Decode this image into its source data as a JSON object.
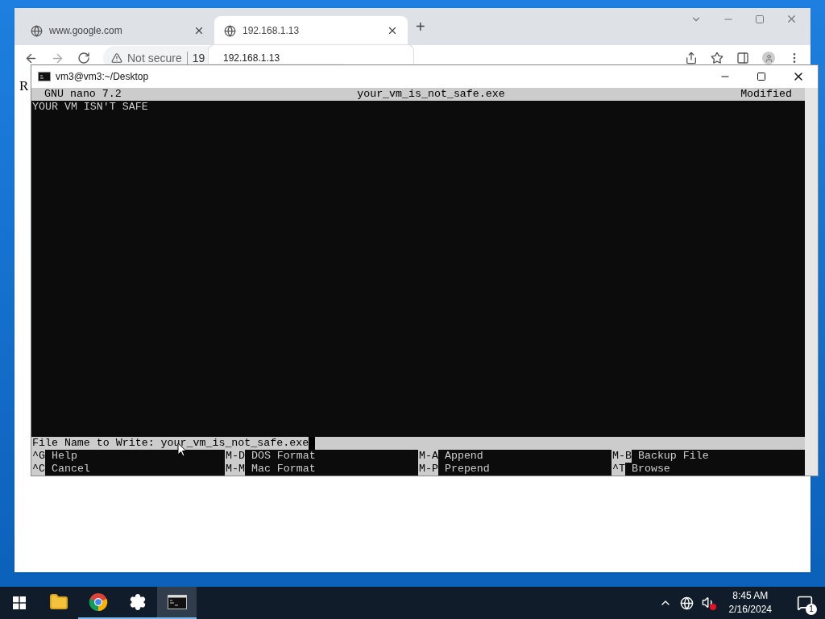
{
  "browser": {
    "tabs": [
      {
        "title": "www.google.com",
        "selected": false
      },
      {
        "title": "192.168.1.13",
        "selected": true
      }
    ],
    "new_tab": "+",
    "security": "Not secure",
    "url": "19",
    "suggestion": "192.168.1.13",
    "page_text": "R"
  },
  "terminal": {
    "title": "vm3@vm3:~/Desktop",
    "header": {
      "app": "GNU nano 7.2",
      "file": "your_vm_is_not_safe.exe",
      "status": "Modified"
    },
    "lines": [
      "YOUR VM ISN'T SAFE"
    ],
    "prompt": {
      "label": "File Name to Write: ",
      "value": "your_vm_is_not_safe.exe"
    },
    "shortcuts": [
      [
        {
          "key": "^G",
          "label": "Help"
        },
        {
          "key": "M-D",
          "label": "DOS Format"
        },
        {
          "key": "M-A",
          "label": "Append"
        },
        {
          "key": "M-B",
          "label": "Backup File"
        }
      ],
      [
        {
          "key": "^C",
          "label": "Cancel"
        },
        {
          "key": "M-M",
          "label": "Mac Format"
        },
        {
          "key": "M-P",
          "label": "Prepend"
        },
        {
          "key": "^T",
          "label": "Browse"
        }
      ]
    ]
  },
  "taskbar": {
    "apps": [
      {
        "kind": "explorer",
        "running": false,
        "selected": false
      },
      {
        "kind": "chrome",
        "running": true,
        "selected": false
      },
      {
        "kind": "settings",
        "running": true,
        "selected": false
      },
      {
        "kind": "terminal",
        "running": true,
        "selected": true
      }
    ],
    "time": "8:45 AM",
    "date": "2/16/2024",
    "notifications": "1"
  }
}
